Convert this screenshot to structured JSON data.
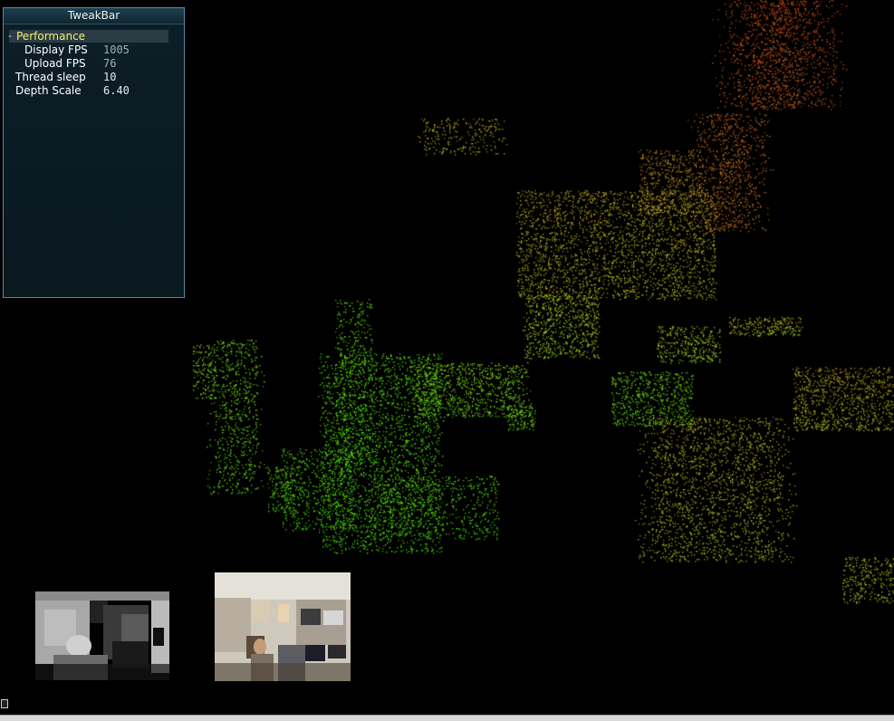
{
  "tweakbar": {
    "title": "TweakBar",
    "group": {
      "toggle": "-",
      "label": "Performance"
    },
    "rows": [
      {
        "label": "Display FPS",
        "value": "1005",
        "readonly": true
      },
      {
        "label": "Upload FPS",
        "value": "76",
        "readonly": true
      },
      {
        "label": "Thread sleep",
        "value": "10",
        "readonly": false
      },
      {
        "label": "Depth Scale",
        "value": "6.40",
        "readonly": false
      }
    ]
  },
  "colors": {
    "background": "#000000",
    "near": "#33ff00",
    "mid": "#b2c21a",
    "far": "#cc3311",
    "group_label": "#f5f06a"
  },
  "icons": {
    "corner": "small-window-icon"
  }
}
